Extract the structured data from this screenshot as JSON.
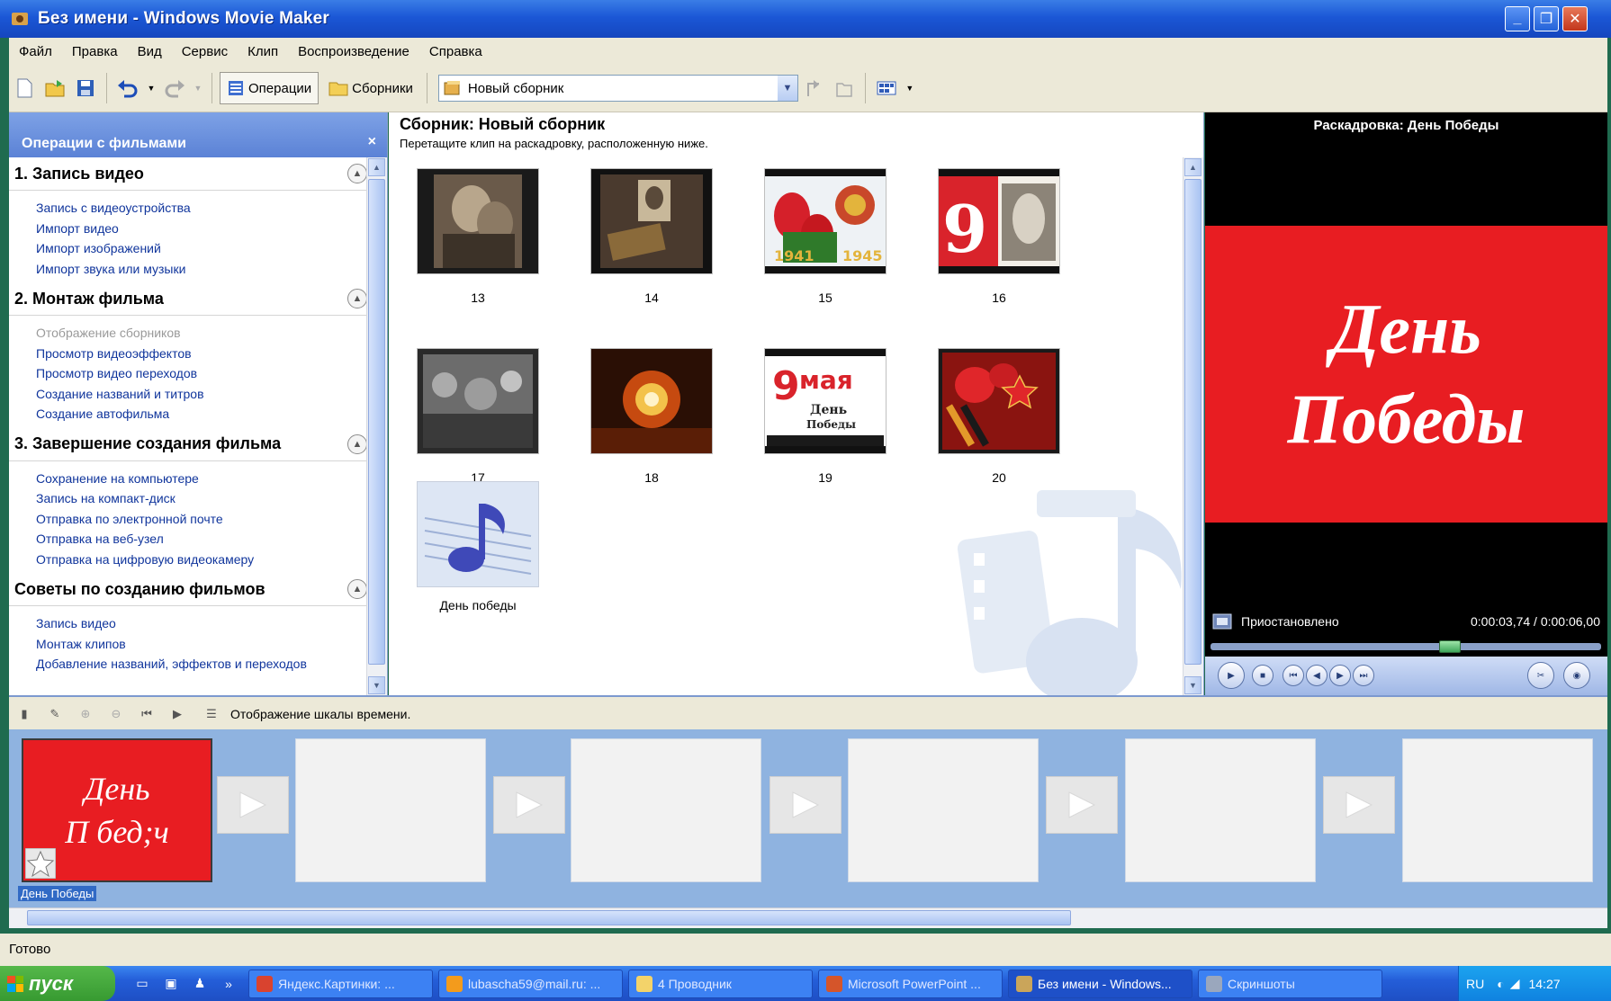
{
  "window": {
    "title": "Без имени - Windows Movie Maker"
  },
  "menu": [
    "Файл",
    "Правка",
    "Вид",
    "Сервис",
    "Клип",
    "Воспроизведение",
    "Справка"
  ],
  "toolbar": {
    "operations_label": "Операции",
    "collections_label": "Сборники",
    "collection_combo_value": "Новый сборник"
  },
  "tasks": {
    "header": "Операции с фильмами",
    "sections": [
      {
        "title": "1. Запись видео",
        "items": [
          "Запись с видеоустройства",
          "Импорт видео",
          "Импорт изображений",
          "Импорт звука или музыки"
        ]
      },
      {
        "title": "2. Монтаж фильма",
        "items": [
          "Отображение сборников",
          "Просмотр видеоэффектов",
          "Просмотр видео переходов",
          "Создание названий и титров",
          "Создание автофильма"
        ]
      },
      {
        "title": "3. Завершение создания фильма",
        "items": [
          "Сохранение на компьютере",
          "Запись на компакт-диск",
          "Отправка по электронной почте",
          "Отправка на веб-узел",
          "Отправка на цифровую видеокамеру"
        ]
      },
      {
        "title": "Советы по созданию фильмов",
        "items": [
          "Запись видео",
          "Монтаж клипов",
          "Добавление названий, эффектов и переходов"
        ]
      }
    ]
  },
  "collection": {
    "title": "Сборник: Новый сборник",
    "subtitle": "Перетащите клип на раскадровку, расположенную ниже.",
    "clips": [
      "13",
      "14",
      "15",
      "16",
      "17",
      "18",
      "19",
      "20"
    ],
    "audio_clip": "День победы"
  },
  "preview": {
    "title": "Раскадровка: День Победы",
    "video_text_line1": "День",
    "video_text_line2": "Победы",
    "status": "Приостановлено",
    "time": "0:00:03,74 / 0:00:06,00",
    "position_fraction": 0.62
  },
  "storyboard": {
    "toggle_label": "Отображение шкалы времени.",
    "first_clip_line1": "День",
    "first_clip_line2": "П бед;ч",
    "first_clip_name": "День Победы"
  },
  "statusbar": {
    "text": "Готово"
  },
  "taskbar": {
    "start_label": "пуск",
    "tasks": [
      "Яндекс.Картинки: ...",
      "lubascha59@mail.ru: ...",
      "4 Проводник",
      "Microsoft PowerPoint ...",
      "Без имени - Windows...",
      "Скриншоты"
    ],
    "lang": "RU",
    "clock": "14:27"
  },
  "colors": {
    "titlebar": "#1b57d6",
    "title_card_red": "#e81d22",
    "storyboard_bg": "#8fb3e0",
    "link_blue": "#10359c"
  }
}
